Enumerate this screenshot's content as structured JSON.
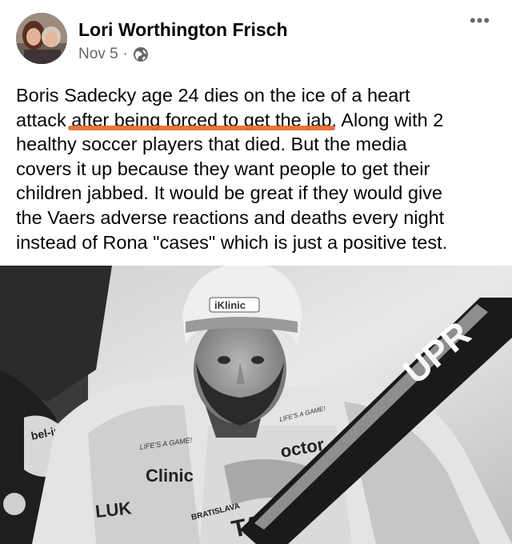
{
  "post": {
    "author": "Lori Worthington Frisch",
    "date": "Nov 5",
    "dot": "·",
    "privacy_icon": "globe-icon",
    "more_icon": "more-options-icon",
    "more_glyph": "•••",
    "text_lines": [
      "Boris Sadecky age 24 dies on the ice of a heart",
      "attack ",
      "after being forced to get the jab",
      ". Along with 2",
      "healthy soccer players that died. But the media",
      "covers it up because they want people to get their",
      "children jabbed. It would be great if they would give",
      "the Vaers adverse reactions and deaths every night",
      "instead of Rona \"cases\" which is just a positive test."
    ],
    "highlight_color": "#e8692a"
  },
  "photo": {
    "helmet_logo": "iKlinic",
    "stick_text": "UPR",
    "chest_text_1": "LIFE'S A GAME!",
    "chest_text_2": "Clinic",
    "chest_text_3": "octor",
    "shoulder_text": "LIFE'S A GAME!",
    "bottom_text": "TALS",
    "bottom_sponsor": "BRATISLAVA",
    "left_player_text": "bel-ir",
    "hem_text": "LUK"
  }
}
